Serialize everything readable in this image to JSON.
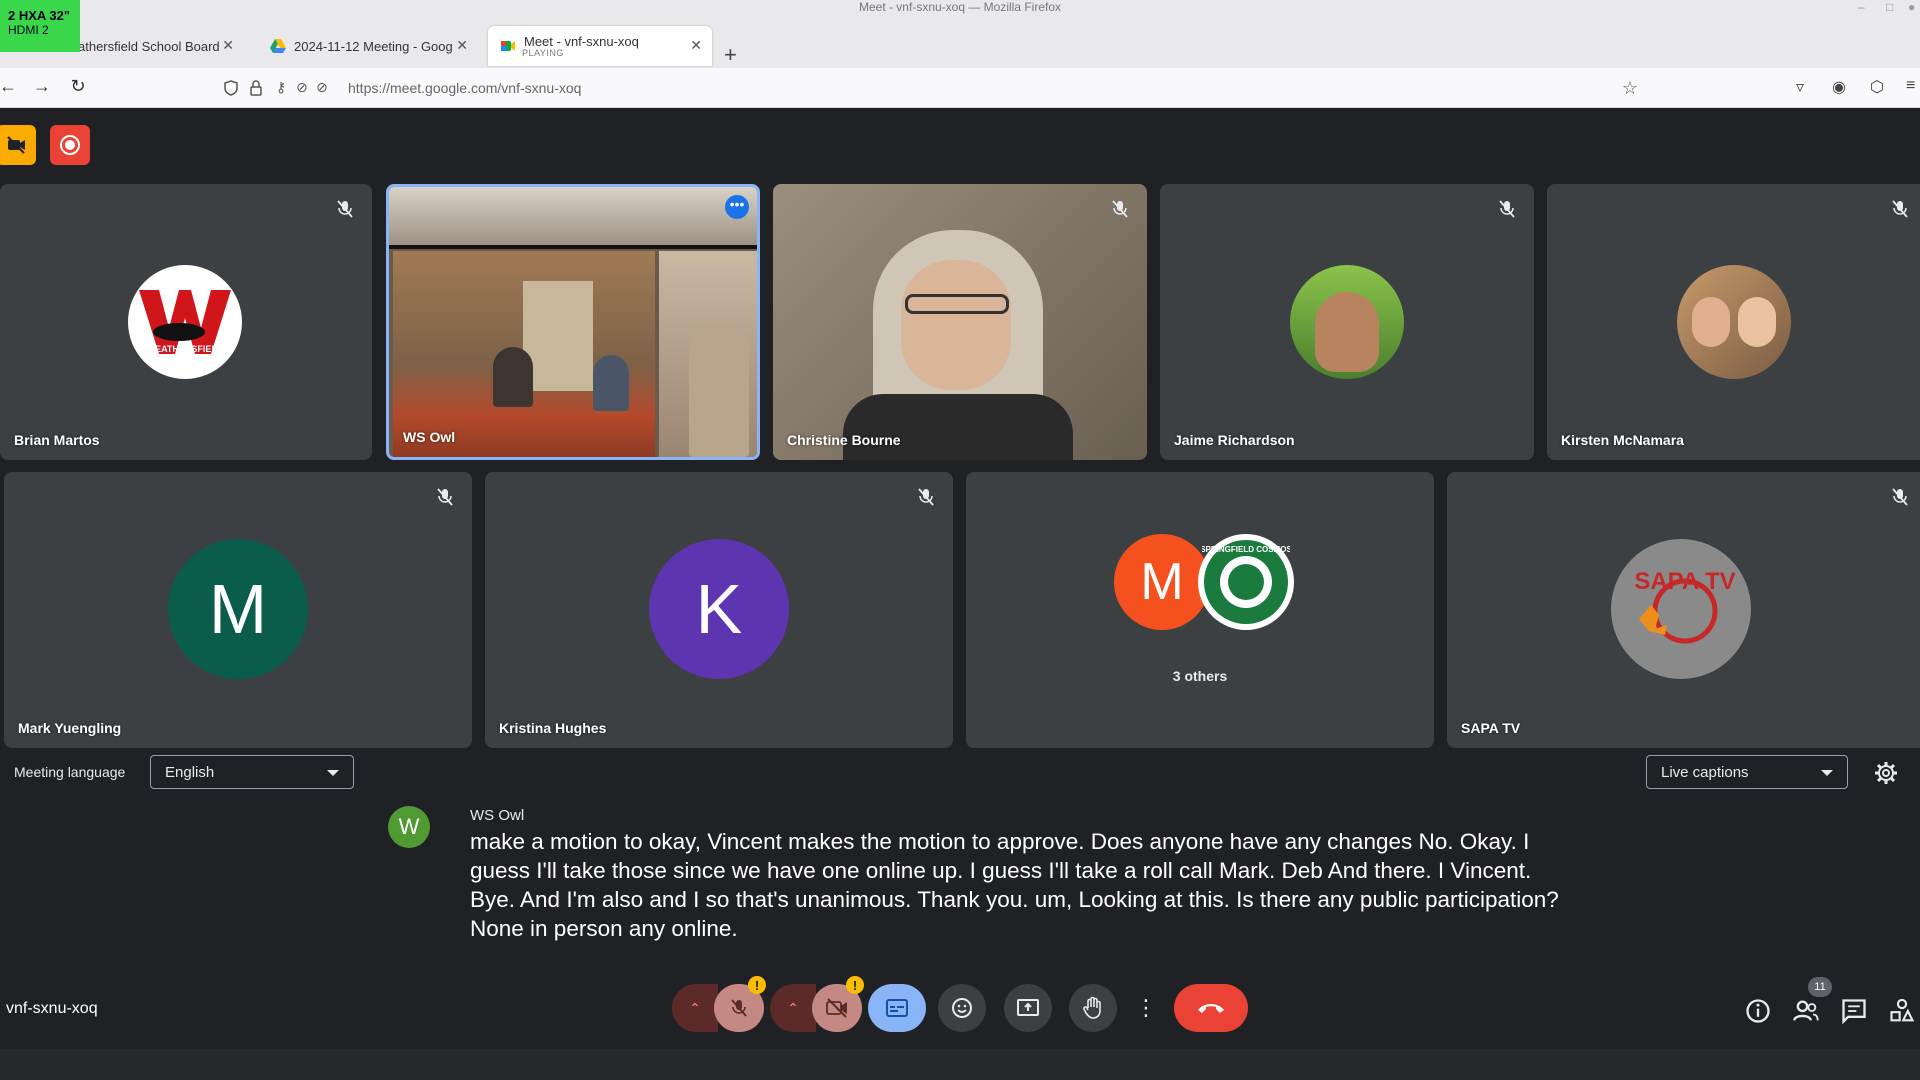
{
  "overlay": {
    "display_label": "2 HXA 32\"",
    "input_label": "HDMI 2"
  },
  "window": {
    "title": "Meet - vnf-sxnu-xoq — Mozilla Firefox"
  },
  "tabs": [
    {
      "label": "athersfield School Board"
    },
    {
      "label": "2024-11-12 Meeting - Goog"
    },
    {
      "label": "Meet - vnf-sxnu-xoq",
      "status": "PLAYING"
    }
  ],
  "address_bar": {
    "url": "https://meet.google.com/vnf-sxnu-xoq"
  },
  "participants": [
    {
      "name": "Brian Martos",
      "avatar_text": "WEATHERSFIELD"
    },
    {
      "name": "WS Owl"
    },
    {
      "name": "Christine Bourne"
    },
    {
      "name": "Jaime Richardson"
    },
    {
      "name": "Kirsten McNamara"
    },
    {
      "name": "Mark Yuengling",
      "initial": "M",
      "color": "#0b5d4b"
    },
    {
      "name": "Kristina Hughes",
      "initial": "K",
      "color": "#5e35b1"
    },
    {
      "name": "",
      "initial": "M",
      "others": "3 others",
      "logo_text": "SPRINGFIELD COSMOS"
    },
    {
      "name": "SAPA TV",
      "logo_text": "SAPA TV"
    }
  ],
  "language": {
    "label": "Meeting language",
    "selected": "English"
  },
  "captions": {
    "mode": "Live captions",
    "speaker": "WS Owl",
    "speaker_initial": "W",
    "text": "make a motion to okay, Vincent makes the motion to approve. Does anyone have any changes No. Okay. I guess I'll take those since we have one online up. I guess I'll take a roll call Mark. Deb And there. I Vincent. Bye. And I'm also and I so that's unanimous. Thank you. um, Looking at this. Is there any public participation? None in person any online."
  },
  "meeting": {
    "code": "vnf-sxnu-xoq",
    "participant_count": "11"
  },
  "colors": {
    "background": "#202124",
    "tile": "#3c4043",
    "end_call": "#ea4335",
    "active_speaker": "#8ab4f8"
  }
}
